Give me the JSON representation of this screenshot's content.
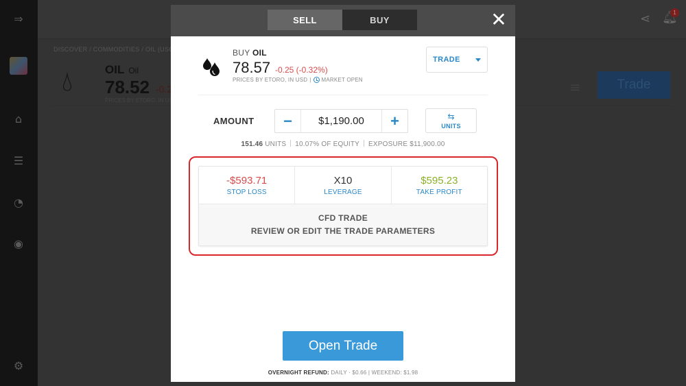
{
  "background": {
    "breadcrumb": "DISCOVER / COMMODITIES / OIL (USO)",
    "instrument_name": "OIL",
    "instrument_sub": "Oil",
    "price": "78.52",
    "change": "-0.2",
    "sub": "PRICES BY ETORO, IN USD",
    "trade_button": "Trade",
    "notification_count": "1"
  },
  "modal": {
    "tabs": {
      "sell": "SELL",
      "buy": "BUY"
    },
    "close_icon": "close-icon",
    "header": {
      "action": "BUY",
      "symbol": "OIL",
      "price": "78.57",
      "change": "-0.25 (-0.32%)",
      "prices_by": "PRICES BY ETORO, IN USD",
      "separator": "|",
      "market_status": "MARKET OPEN"
    },
    "order_type": {
      "label": "TRADE"
    },
    "amount": {
      "label": "AMOUNT",
      "value": "$1,190.00",
      "minus": "−",
      "plus": "+"
    },
    "units_toggle": {
      "label": "UNITS"
    },
    "stats": {
      "units_value": "151.46",
      "units_label": "UNITS",
      "equity": "10.07% OF EQUITY",
      "exposure_label": "EXPOSURE",
      "exposure_value": "$11,900.00"
    },
    "params": {
      "stop_loss": {
        "value": "-$593.71",
        "label": "STOP LOSS"
      },
      "leverage": {
        "value": "X10",
        "label": "LEVERAGE"
      },
      "take_profit": {
        "value": "$595.23",
        "label": "TAKE PROFIT"
      }
    },
    "cfd": {
      "line1": "CFD TRADE",
      "line2": "REVIEW OR EDIT THE TRADE PARAMETERS"
    },
    "open_trade": "Open Trade",
    "refund": {
      "label": "OVERNIGHT REFUND:",
      "daily": "DAILY · $0.66 | WEEKEND: $1.98"
    }
  },
  "colors": {
    "accent": "#2a88c8",
    "open_button": "#3a9ad9",
    "loss": "#d84b4b",
    "profit": "#8bb02a",
    "highlight": "#d9262b"
  }
}
